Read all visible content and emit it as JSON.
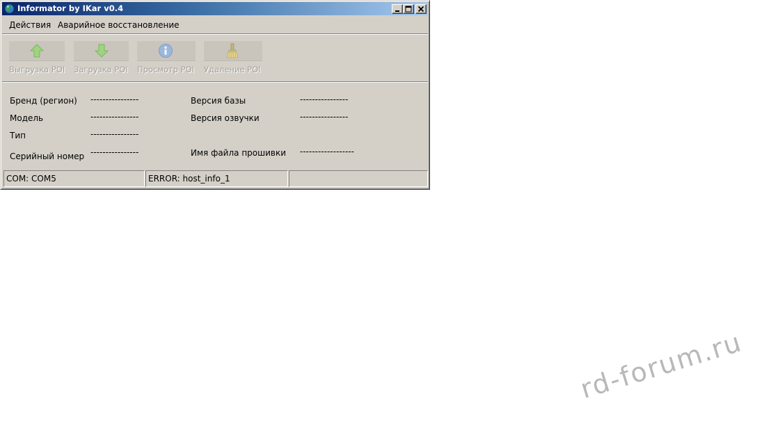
{
  "window": {
    "title": "Informator by IKar v0.4"
  },
  "menu": {
    "actions": "Действия",
    "recovery": "Аварийное восстановление"
  },
  "toolbar": {
    "export_label": "Выгрузка POI",
    "import_label": "Загрузка POI",
    "view_label": "Просмотр POI",
    "delete_label": "Удаление POI"
  },
  "info": {
    "brand_label": "Бренд (регион)",
    "brand_value": "----------------",
    "model_label": "Модель",
    "model_value": "----------------",
    "type_label": "Тип",
    "type_value": "----------------",
    "serial_label": "Серийный номер",
    "serial_value": "----------------",
    "db_version_label": "Версия базы",
    "db_version_value": "----------------",
    "voice_version_label": "Версия озвучки",
    "voice_version_value": "----------------",
    "firmware_file_label": "Имя файла прошивки",
    "firmware_file_value": "------------------"
  },
  "statusbar": {
    "com": "COM: COM5",
    "error": "ERROR: host_info_1",
    "extra": ""
  },
  "watermark": "rd-forum.ru",
  "colors": {
    "titlebar_start": "#0a246a",
    "titlebar_end": "#a6caf0",
    "window_face": "#d4d0c8",
    "disabled_text": "#a4a098"
  }
}
